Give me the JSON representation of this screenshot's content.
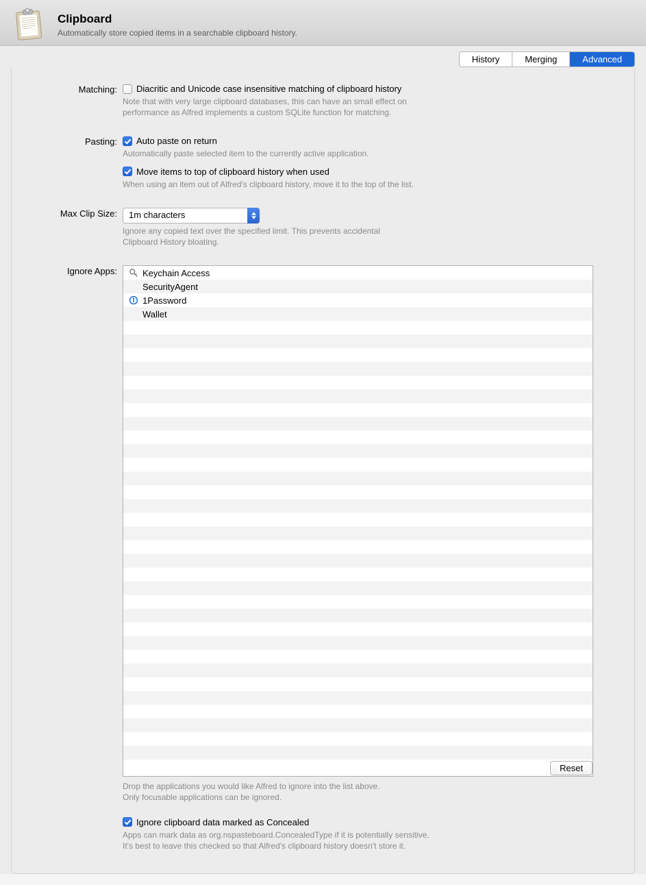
{
  "header": {
    "title": "Clipboard",
    "subtitle": "Automatically store copied items in a searchable clipboard history."
  },
  "tabs": {
    "history": "History",
    "merging": "Merging",
    "advanced": "Advanced"
  },
  "labels": {
    "matching": "Matching:",
    "pasting": "Pasting:",
    "max_clip_size": "Max Clip Size:",
    "ignore_apps": "Ignore Apps:"
  },
  "matching": {
    "checkbox_label": "Diacritic and Unicode case insensitive matching of clipboard history",
    "desc": "Note that with very large clipboard databases, this can have an small effect on performance as Alfred implements a custom SQLite function for matching.",
    "checked": false
  },
  "pasting": {
    "auto_paste_label": "Auto paste on return",
    "auto_paste_desc": "Automatically paste selected item to the currently active application.",
    "auto_paste_checked": true,
    "move_top_label": "Move items to top of clipboard history when used",
    "move_top_desc": "When using an item out of Alfred's clipboard history, move it to the top of the list.",
    "move_top_checked": true
  },
  "max_clip": {
    "value": "1m characters",
    "desc": "Ignore any copied text over the specified limit. This prevents accidental Clipboard History bloating."
  },
  "ignore_apps": {
    "items": [
      {
        "name": "Keychain Access",
        "icon": "keychain"
      },
      {
        "name": "SecurityAgent",
        "icon": ""
      },
      {
        "name": "1Password",
        "icon": "onepassword"
      },
      {
        "name": "Wallet",
        "icon": ""
      }
    ],
    "note_line1": "Drop the applications you would like Alfred to ignore into the list above.",
    "note_line2": "Only focusable applications can be ignored.",
    "reset": "Reset"
  },
  "concealed": {
    "label": "Ignore clipboard data marked as Concealed",
    "desc_line1": "Apps can mark data as org.nspasteboard.ConcealedType if it is potentially sensitive.",
    "desc_line2": "It's best to leave this checked so that Alfred's clipboard history doesn't store it.",
    "checked": true
  }
}
